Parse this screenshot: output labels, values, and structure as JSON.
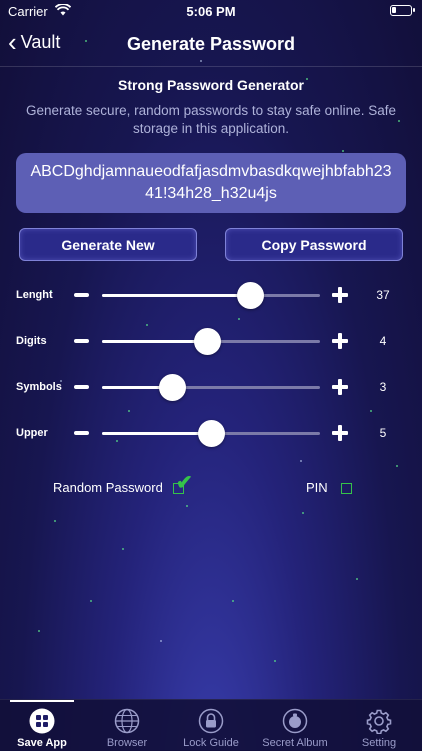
{
  "status": {
    "carrier": "Carrier",
    "time": "5:06 PM"
  },
  "nav": {
    "back_label": "Vault",
    "title": "Generate Password"
  },
  "generator": {
    "subtitle": "Strong Password Generator",
    "description": "Generate secure, random passwords to stay safe online. Safe storage in this application.",
    "password": "ABCDghdjamnaueodfafjasdmvbasdkqwejhbfabh2341!34h28_h32u4js",
    "generate_label": "Generate New",
    "copy_label": "Copy Password"
  },
  "sliders": [
    {
      "label": "Lenght",
      "value": "37",
      "fraction": 0.68
    },
    {
      "label": "Digits",
      "value": "4",
      "fraction": 0.48
    },
    {
      "label": "Symbols",
      "value": "3",
      "fraction": 0.32
    },
    {
      "label": "Upper",
      "value": "5",
      "fraction": 0.5
    }
  ],
  "options": {
    "random_label": "Random Password",
    "random_checked": true,
    "pin_label": "PIN",
    "pin_checked": false
  },
  "tabs": [
    {
      "label": "Save App",
      "icon": "grid-icon",
      "active": true
    },
    {
      "label": "Browser",
      "icon": "globe-icon",
      "active": false
    },
    {
      "label": "Lock Guide",
      "icon": "lock-icon",
      "active": false
    },
    {
      "label": "Secret Album",
      "icon": "album-icon",
      "active": false
    },
    {
      "label": "Setting",
      "icon": "gear-icon",
      "active": false
    }
  ],
  "colors": {
    "accent_green": "#35c24a",
    "password_box": "#5d5fb5",
    "button_border": "#7f82d8"
  }
}
